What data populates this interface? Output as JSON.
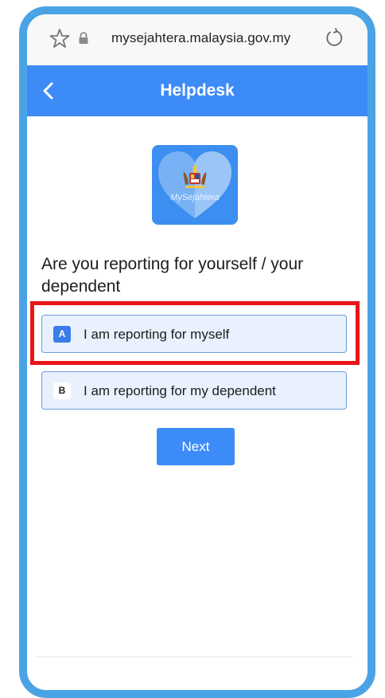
{
  "browser": {
    "url": "mysejahtera.malaysia.gov.my"
  },
  "header": {
    "title": "Helpdesk"
  },
  "logo": {
    "text": "MySejahtera"
  },
  "question": {
    "text": "Are you reporting for yourself / your dependent"
  },
  "options": [
    {
      "key": "A",
      "label": "I am reporting for myself"
    },
    {
      "key": "B",
      "label": "I am reporting for my dependent"
    }
  ],
  "next_button": {
    "label": "Next"
  },
  "colors": {
    "frame": "#4aa3e4",
    "accent": "#3d8bf7",
    "highlight": "#e8141a",
    "option_bg": "#e9f1fe"
  }
}
